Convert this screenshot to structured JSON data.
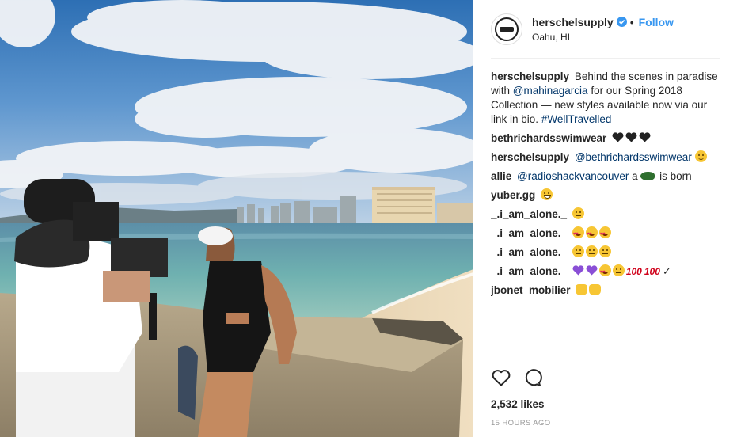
{
  "header": {
    "username": "herschelsupply",
    "dot": "•",
    "follow_label": "Follow",
    "location": "Oahu, HI"
  },
  "caption": {
    "user": "herschelsupply",
    "text_1": "Behind the scenes in paradise with",
    "mention": "@mahinagarcia",
    "text_2": "for our Spring 2018 Collection — new styles available now via our link in bio.",
    "hashtag": "#WellTravelled"
  },
  "comments": [
    {
      "user": "bethrichardsswimwear",
      "text": "",
      "emoji": [
        "black-heart",
        "black-heart",
        "black-heart"
      ]
    },
    {
      "user": "herschelsupply",
      "mention": "@bethrichardsswimwear",
      "emoji": [
        "slight-smile"
      ]
    },
    {
      "user": "allie",
      "mention": "@radioshackvancouver",
      "text": "a",
      "text_after": "is born",
      "emoji": [
        "fish"
      ]
    },
    {
      "user": "yuber.gg",
      "emoji": [
        "grinning"
      ]
    },
    {
      "user": "_.i_am_alone._",
      "emoji": [
        "pensive"
      ]
    },
    {
      "user": "_.i_am_alone._",
      "emoji": [
        "heart-eyes",
        "heart-eyes",
        "heart-eyes"
      ]
    },
    {
      "user": "_.i_am_alone._",
      "emoji": [
        "pensive",
        "pensive",
        "pensive"
      ]
    },
    {
      "user": "_.i_am_alone._",
      "emoji": [
        "purple-heart",
        "purple-heart",
        "heart-eyes",
        "pensive",
        "hundred",
        "hundred"
      ],
      "tail": "✓"
    },
    {
      "user": "jbonet_mobilier",
      "emoji": [
        "punch",
        "thumbs-up"
      ]
    }
  ],
  "likes": "2,532 likes",
  "timestamp": "15 HOURS AGO",
  "colors": {
    "link": "#003569",
    "follow": "#3897f0",
    "verified": "#3897f0"
  }
}
